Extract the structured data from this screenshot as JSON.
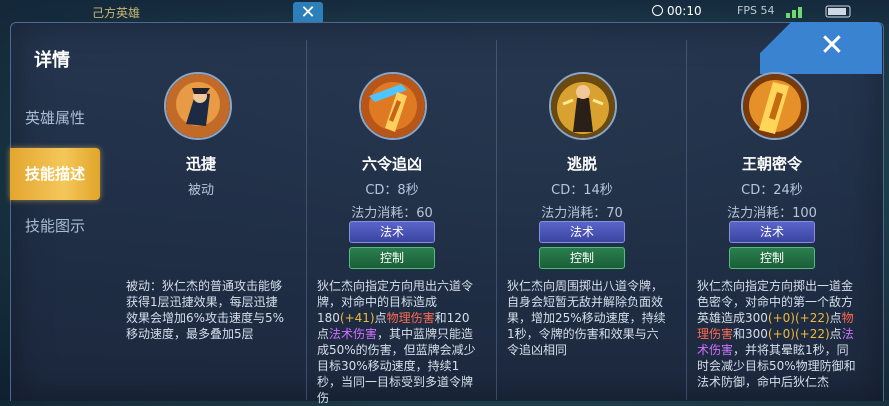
{
  "hud": {
    "team_label": "己方英雄",
    "timer": "00:10",
    "fps": "FPS 54"
  },
  "sidebar": {
    "title": "详情",
    "items": [
      {
        "label": "英雄属性",
        "active": false
      },
      {
        "label": "技能描述",
        "active": true
      },
      {
        "label": "技能图示",
        "active": false
      }
    ]
  },
  "close_icon": "close-icon",
  "skills": [
    {
      "name": "迅捷",
      "type": "被动",
      "cd": "",
      "cost": "",
      "tags": [],
      "description": [
        {
          "t": "被动：狄仁杰的普通攻击能够获得1层迅捷效果，每层迅捷效果会增加6%攻击速度与5%移动速度，最多叠加5层",
          "c": ""
        }
      ],
      "icon": "passive-skill-icon"
    },
    {
      "name": "六令追凶",
      "type": "",
      "cd": "CD：8秒",
      "cost": "法力消耗：60",
      "tags": [
        "法术",
        "控制"
      ],
      "description": [
        {
          "t": "狄仁杰向指定方向甩出六道令牌，对命中的目标造成180",
          "c": ""
        },
        {
          "t": "(+41)",
          "c": "g"
        },
        {
          "t": "点",
          "c": ""
        },
        {
          "t": "物理伤害",
          "c": "r"
        },
        {
          "t": "和120点",
          "c": ""
        },
        {
          "t": "法术伤害",
          "c": "v"
        },
        {
          "t": "，其中蓝牌只能造成50%的伤害，但蓝牌会减少目标30%移动速度，持续1秒，当同一目标受到多道令牌伤",
          "c": ""
        }
      ],
      "icon": "six-token-skill-icon"
    },
    {
      "name": "逃脱",
      "type": "",
      "cd": "CD：14秒",
      "cost": "法力消耗：70",
      "tags": [
        "法术",
        "控制"
      ],
      "description": [
        {
          "t": "狄仁杰向周围掷出八道令牌，自身会短暂无敌并解除负面效果，增加25%移动速度，持续1秒，令牌的伤害和效果与六令追凶相同",
          "c": ""
        }
      ],
      "icon": "escape-skill-icon"
    },
    {
      "name": "王朝密令",
      "type": "",
      "cd": "CD：24秒",
      "cost": "法力消耗：100",
      "tags": [
        "法术",
        "控制"
      ],
      "description": [
        {
          "t": "狄仁杰向指定方向掷出一道金色密令，对命中的第一个敌方英雄造成300",
          "c": ""
        },
        {
          "t": "(+0)",
          "c": "g"
        },
        {
          "t": "(+22)",
          "c": "g"
        },
        {
          "t": "点",
          "c": ""
        },
        {
          "t": "物理伤害",
          "c": "r"
        },
        {
          "t": "和300",
          "c": ""
        },
        {
          "t": "(+0)",
          "c": "g"
        },
        {
          "t": "(+22)",
          "c": "g"
        },
        {
          "t": "点",
          "c": ""
        },
        {
          "t": "法术伤害",
          "c": "v"
        },
        {
          "t": "，并将其晕眩1秒，同时会减少目标50%物理防御和法术防御，命中后狄仁杰",
          "c": ""
        }
      ],
      "icon": "dynasty-order-skill-icon"
    }
  ]
}
